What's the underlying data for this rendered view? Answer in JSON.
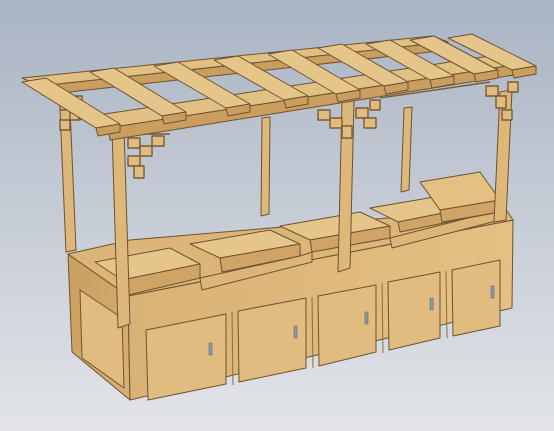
{
  "scene": {
    "subject": "wooden-market-stall-pergola",
    "background_top": "#a9b4c3",
    "background_bottom": "#e2e4e7",
    "wood_light": "#e6c58a",
    "wood_mid": "#d9b275",
    "wood_dark": "#b98e52",
    "edge_color": "#6e5230"
  }
}
